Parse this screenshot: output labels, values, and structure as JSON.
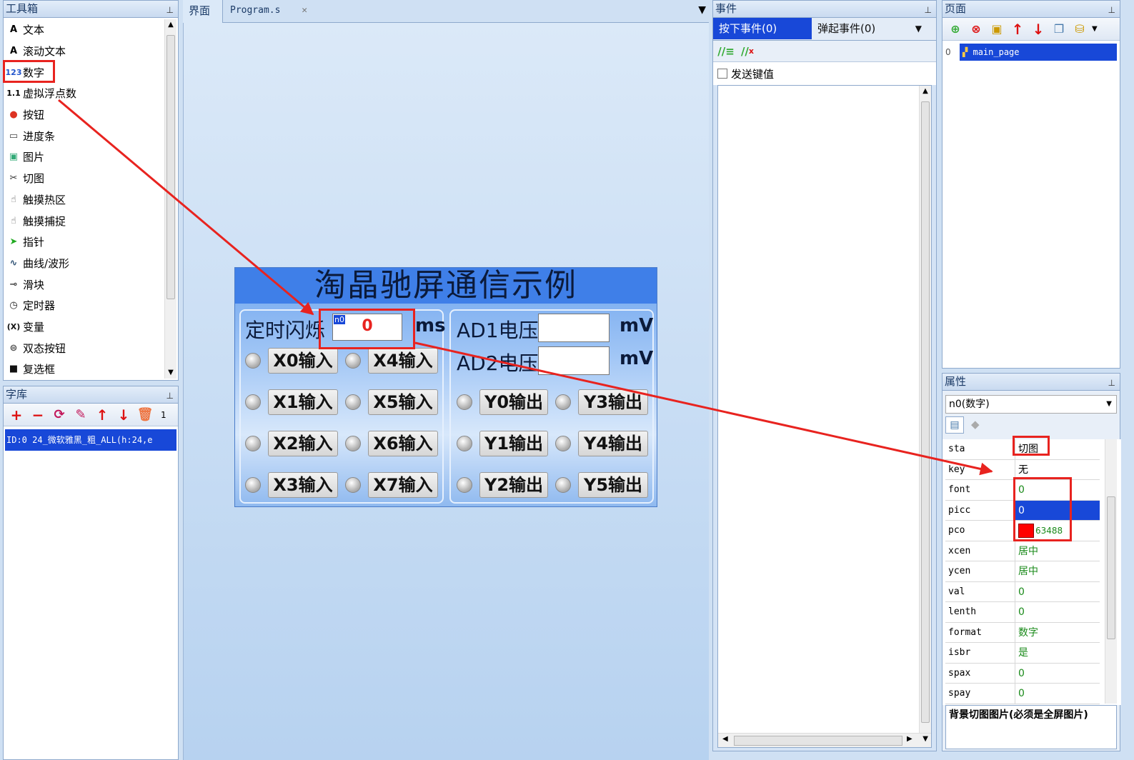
{
  "toolbox": {
    "title": "工具箱",
    "items": [
      {
        "label": "文本",
        "icon": "A"
      },
      {
        "label": "滚动文本",
        "icon": "A"
      },
      {
        "label": "数字",
        "icon": "123"
      },
      {
        "label": "虚拟浮点数",
        "icon": "1.1"
      },
      {
        "label": "按钮",
        "icon": "●"
      },
      {
        "label": "进度条",
        "icon": "▭"
      },
      {
        "label": "图片",
        "icon": "▣"
      },
      {
        "label": "切图",
        "icon": "✂"
      },
      {
        "label": "触摸热区",
        "icon": "☝"
      },
      {
        "label": "触摸捕捉",
        "icon": "☝"
      },
      {
        "label": "指针",
        "icon": "➤"
      },
      {
        "label": "曲线/波形",
        "icon": "∿"
      },
      {
        "label": "滑块",
        "icon": "⊸"
      },
      {
        "label": "定时器",
        "icon": "◷"
      },
      {
        "label": "变量",
        "icon": "(X)"
      },
      {
        "label": "双态按钮",
        "icon": "⊜"
      },
      {
        "label": "复选框",
        "icon": "■"
      }
    ]
  },
  "fontlib": {
    "title": "字库",
    "count": "1",
    "entry": "ID:0   24_微软雅黑_粗_ALL(h:24,e"
  },
  "tabs": [
    {
      "label": "界面"
    },
    {
      "label": "Program.s"
    }
  ],
  "tab_close_glyph": "✕",
  "hmi": {
    "title": "淘晶驰屏通信示例",
    "timer_label": "定时闪烁",
    "number_id": "n0",
    "number_value": "0",
    "unit_ms": "ms",
    "ad1_label": "AD1电压:",
    "ad2_label": "AD2电压:",
    "unit_mv": "mV",
    "inputs_left": [
      "X0输入",
      "X1输入",
      "X2输入",
      "X3输入"
    ],
    "inputs_right": [
      "X4输入",
      "X5输入",
      "X6输入",
      "X7输入"
    ],
    "outputs_left": [
      "Y0输出",
      "Y1输出",
      "Y2输出"
    ],
    "outputs_right": [
      "Y3输出",
      "Y4输出",
      "Y5输出"
    ]
  },
  "events": {
    "title": "事件",
    "tab_press": "按下事件(0)",
    "tab_release": "弹起事件(0)",
    "send_key_label": "发送键值"
  },
  "pages": {
    "title": "页面",
    "index": "0",
    "item": "main_page"
  },
  "props": {
    "title": "属性",
    "selected": "n0(数字)",
    "rows": [
      {
        "name": "sta",
        "value": "切图"
      },
      {
        "name": "key",
        "value": "无"
      },
      {
        "name": "font",
        "value": "0"
      },
      {
        "name": "picc",
        "value": "0"
      },
      {
        "name": "pco",
        "value": "63488"
      },
      {
        "name": "xcen",
        "value": "居中"
      },
      {
        "name": "ycen",
        "value": "居中"
      },
      {
        "name": "val",
        "value": "0"
      },
      {
        "name": "lenth",
        "value": "0"
      },
      {
        "name": "format",
        "value": "数字"
      },
      {
        "name": "isbr",
        "value": "是"
      },
      {
        "name": "spax",
        "value": "0"
      },
      {
        "name": "spay",
        "value": "0"
      }
    ],
    "description": "背景切图图片(必须是全屏图片)"
  },
  "colors": {
    "accent": "#1848d8",
    "annotation": "#e8231f",
    "pco_swatch": "#ff0000"
  }
}
